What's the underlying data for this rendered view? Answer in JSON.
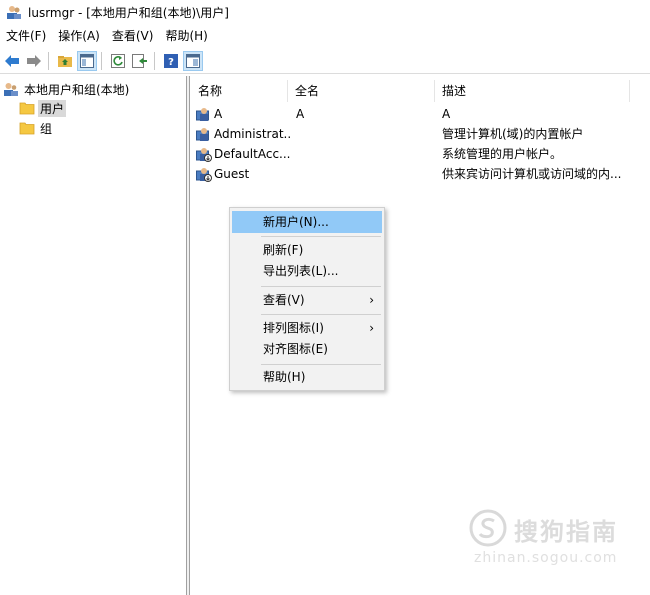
{
  "window": {
    "title": "lusrmgr - [本地用户和组(本地)\\用户]"
  },
  "menubar": {
    "items": [
      "文件(F)",
      "操作(A)",
      "查看(V)",
      "帮助(H)"
    ]
  },
  "toolbar": {
    "buttons": [
      "back-icon",
      "forward-icon",
      "up-folder-icon",
      "show-tree-icon",
      "refresh-icon",
      "export-icon",
      "help-icon",
      "console-icon"
    ]
  },
  "tree": {
    "root": "本地用户和组(本地)",
    "items": [
      "用户",
      "组"
    ],
    "selected": "用户"
  },
  "list": {
    "columns": [
      "名称",
      "全名",
      "描述"
    ],
    "rows": [
      {
        "name": "A",
        "full_name": "A",
        "description": "A"
      },
      {
        "name": "Administrat...",
        "full_name": "",
        "description": "管理计算机(域)的内置帐户"
      },
      {
        "name": "DefaultAcc...",
        "full_name": "",
        "description": "系统管理的用户帐户。"
      },
      {
        "name": "Guest",
        "full_name": "",
        "description": "供来宾访问计算机或访问域的内..."
      }
    ]
  },
  "context_menu": {
    "items": [
      {
        "label": "新用户(N)...",
        "highlighted": true,
        "submenu": false
      },
      {
        "label": "刷新(F)",
        "highlighted": false,
        "submenu": false
      },
      {
        "label": "导出列表(L)...",
        "highlighted": false,
        "submenu": false
      },
      {
        "label": "查看(V)",
        "highlighted": false,
        "submenu": true
      },
      {
        "label": "排列图标(I)",
        "highlighted": false,
        "submenu": true
      },
      {
        "label": "对齐图标(E)",
        "highlighted": false,
        "submenu": false
      },
      {
        "label": "帮助(H)",
        "highlighted": false,
        "submenu": false
      }
    ],
    "submenu_arrow": "›"
  },
  "watermark": {
    "text": "搜狗指南",
    "url": "zhinan.sogou.com"
  },
  "colors": {
    "highlight": "#91c9f7",
    "selection": "#d9d9d9",
    "folder": "#f5c842"
  }
}
